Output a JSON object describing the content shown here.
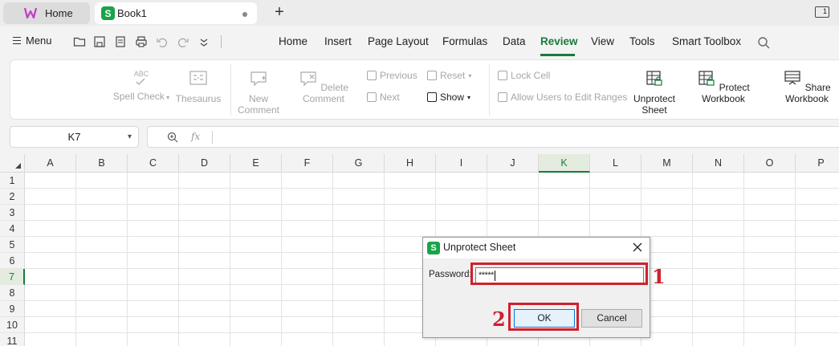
{
  "tabs": {
    "home_label": "Home",
    "book_label": "Book1",
    "book_badge": "S"
  },
  "menubar": {
    "menu_label": "Menu",
    "items": [
      "Home",
      "Insert",
      "Page Layout",
      "Formulas",
      "Data",
      "Review",
      "View",
      "Tools",
      "Smart Toolbox"
    ],
    "active": "Review"
  },
  "ribbon": {
    "spell_check": "Spell Check",
    "thesaurus": "Thesaurus",
    "new_comment_1": "New",
    "new_comment_2": "Comment",
    "delete_comment": "Delete Comment",
    "previous": "Previous",
    "next": "Next",
    "reset": "Reset",
    "show": "Show",
    "lock_cell": "Lock Cell",
    "allow_users": "Allow Users to Edit Ranges",
    "unprotect_1": "Unprotect",
    "unprotect_2": "Sheet",
    "protect_workbook": "Protect Workbook",
    "share_workbook": "Share Workbook",
    "abc_glyph": "ABC"
  },
  "formula_bar": {
    "cell_ref": "K7",
    "fx": "fx",
    "value": ""
  },
  "grid": {
    "columns": [
      "A",
      "B",
      "C",
      "D",
      "E",
      "F",
      "G",
      "H",
      "I",
      "J",
      "K",
      "L",
      "M",
      "N",
      "O",
      "P"
    ],
    "rows": [
      "1",
      "2",
      "3",
      "4",
      "5",
      "6",
      "7",
      "8",
      "9",
      "10",
      "11"
    ],
    "selected_column": "K",
    "selected_row": "7"
  },
  "dialog": {
    "badge": "S",
    "title": "Unprotect Sheet",
    "password_label": "Password:",
    "password_value": "*****",
    "ok_label": "OK",
    "cancel_label": "Cancel"
  },
  "annotations": {
    "step1": "1",
    "step2": "2",
    "color": "#d0202e"
  },
  "colors": {
    "accent": "#1a7a3a",
    "sheet_badge": "#1aa34a"
  }
}
